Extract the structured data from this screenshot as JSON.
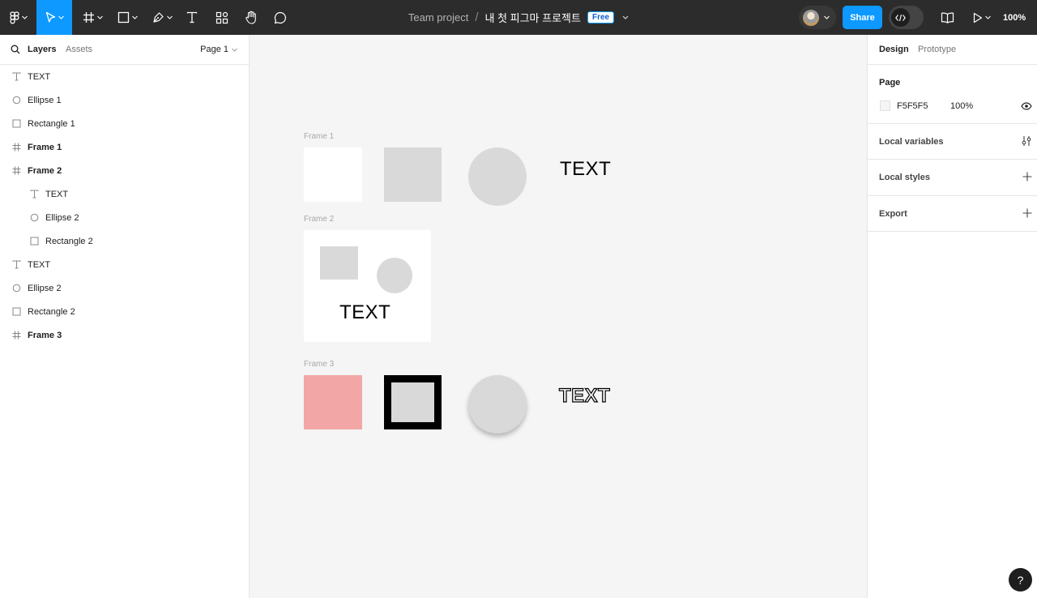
{
  "toolbar": {
    "team": "Team project",
    "separator": "/",
    "file_name": "내 첫 피그마 프로젝트",
    "plan_badge": "Free",
    "share_label": "Share",
    "zoom": "100%"
  },
  "left_panel": {
    "tabs": [
      {
        "label": "Layers",
        "active": true
      },
      {
        "label": "Assets",
        "active": false
      }
    ],
    "page_selector": "Page 1",
    "layers": [
      {
        "label": "TEXT",
        "icon": "text-icon",
        "depth": 0
      },
      {
        "label": "Ellipse 1",
        "icon": "ellipse-icon",
        "depth": 0
      },
      {
        "label": "Rectangle 1",
        "icon": "rectangle-icon",
        "depth": 0
      },
      {
        "label": "Frame 1",
        "icon": "frame-icon",
        "depth": 0
      },
      {
        "label": "Frame 2",
        "icon": "frame-icon",
        "depth": 0
      },
      {
        "label": "TEXT",
        "icon": "text-icon",
        "depth": 1
      },
      {
        "label": "Ellipse 2",
        "icon": "ellipse-icon",
        "depth": 1
      },
      {
        "label": "Rectangle 2",
        "icon": "rectangle-icon",
        "depth": 1
      },
      {
        "label": "TEXT",
        "icon": "text-icon",
        "depth": 0
      },
      {
        "label": "Ellipse 2",
        "icon": "ellipse-icon",
        "depth": 0
      },
      {
        "label": "Rectangle 2",
        "icon": "rectangle-icon",
        "depth": 0
      },
      {
        "label": "Frame 3",
        "icon": "frame-icon",
        "depth": 0
      }
    ]
  },
  "canvas": {
    "frame1_label": "Frame 1",
    "frame2_label": "Frame 2",
    "frame3_label": "Frame 3",
    "text1": "TEXT",
    "text2": "TEXT",
    "text3": "TEXT",
    "colors": {
      "background": "#F5F5F5",
      "shape_fill": "#D9D9D9",
      "pink_fill": "#F3A6A6",
      "stroke": "#000000"
    }
  },
  "right_panel": {
    "tabs": [
      {
        "label": "Design",
        "active": true
      },
      {
        "label": "Prototype",
        "active": false
      }
    ],
    "page_section_title": "Page",
    "page_color_hex": "F5F5F5",
    "page_opacity": "100%",
    "sections": [
      {
        "title": "Local variables",
        "icon": "variables-icon"
      },
      {
        "title": "Local styles",
        "icon": "plus-icon"
      },
      {
        "title": "Export",
        "icon": "plus-icon"
      }
    ]
  },
  "help_label": "?"
}
